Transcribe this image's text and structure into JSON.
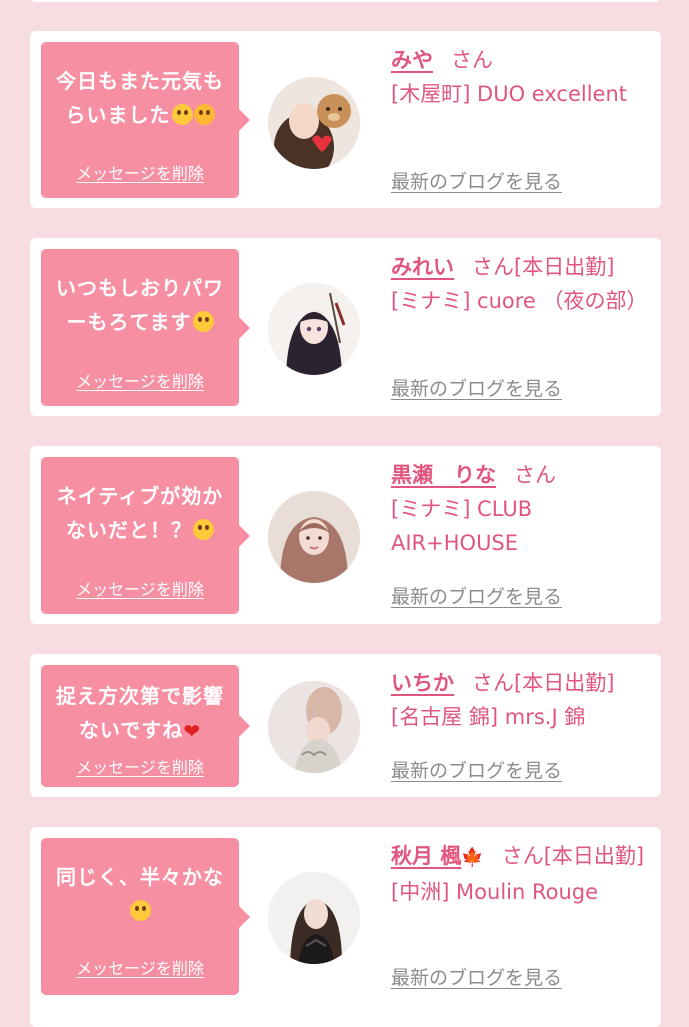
{
  "delete_label": "メッセージを削除",
  "blog_label": "最新のブログを見る",
  "san_label": "さん",
  "messages": [
    {
      "text_line1": "今日もまた元気も",
      "text_line2": "らいました",
      "emoji": "pleading-and-smiling-hearts",
      "cast": {
        "name": "みや",
        "suffix": "",
        "shop": "[木屋町] DUO excellent"
      }
    },
    {
      "text_line1": "いつもしおりパワ",
      "text_line2": "ーもろてます",
      "emoji": "heart-eyes",
      "cast": {
        "name": "みれい",
        "suffix": "[本日出勤]",
        "shop": "[ミナミ] cuore （夜の部）"
      }
    },
    {
      "text_line1": "ネイティブが効か",
      "text_line2": "ないだと！？",
      "emoji": "flushed",
      "cast": {
        "name": "黒瀬　りな",
        "suffix": "",
        "shop": "[ミナミ] CLUB AIR+HOUSE"
      }
    },
    {
      "text_line1": "捉え方次第で影響",
      "text_line2": "ないですね",
      "emoji": "red-heart",
      "cast": {
        "name": "いちか",
        "suffix": "[本日出勤]",
        "shop": "[名古屋 錦] mrs.J 錦"
      }
    },
    {
      "text_line1": "同じく、半々かな",
      "text_line2": "",
      "emoji": "slight-smile",
      "cast": {
        "name": "秋月 楓",
        "name_icon": "maple-leaf",
        "suffix": "[本日出勤]",
        "shop": "[中洲] Moulin Rouge"
      }
    }
  ],
  "colors": {
    "background": "#f7dce2",
    "bubble": "#f78fa2",
    "accent_text": "#e0567f",
    "link_gray": "#8c8c8c"
  }
}
